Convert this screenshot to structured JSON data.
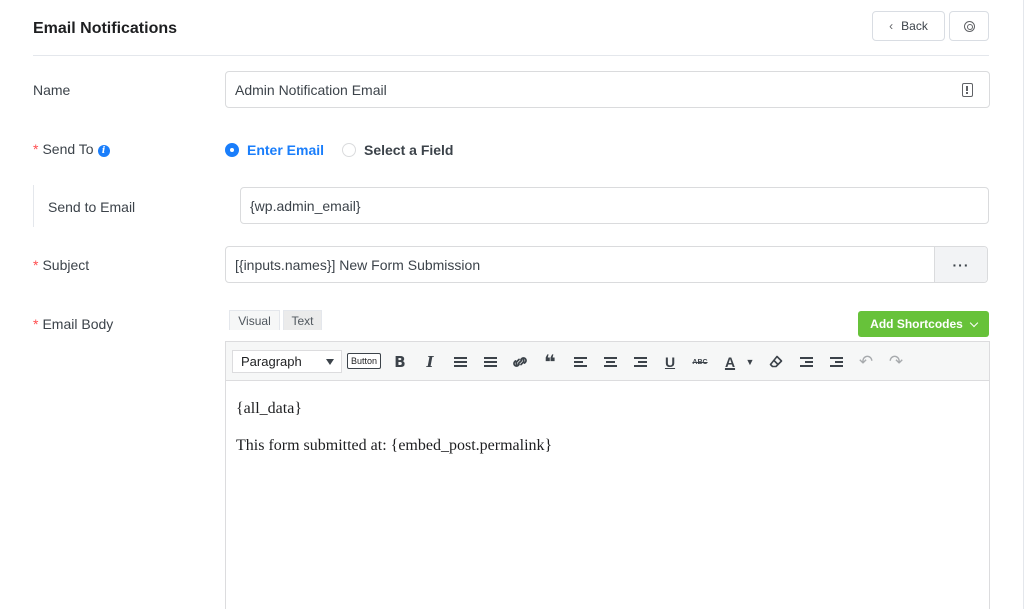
{
  "header": {
    "title": "Email Notifications",
    "back_label": "Back"
  },
  "fields": {
    "name": {
      "label": "Name",
      "value": "Admin Notification Email"
    },
    "send_to": {
      "label": "Send To",
      "options": [
        {
          "label": "Enter Email",
          "checked": true
        },
        {
          "label": "Select a Field",
          "checked": false
        }
      ]
    },
    "send_to_email": {
      "label": "Send to Email",
      "value": "{wp.admin_email}"
    },
    "subject": {
      "label": "Subject",
      "value": "[{inputs.names}] New Form Submission",
      "more_label": "···"
    },
    "email_body": {
      "label": "Email Body"
    }
  },
  "editor": {
    "tabs": [
      "Visual",
      "Text"
    ],
    "add_shortcodes_label": "Add Shortcodes",
    "format_select": "Paragraph",
    "button_tag": "Button",
    "toolbar_glyphs": {
      "bold": "B",
      "italic": "I",
      "quote": "❝",
      "underline": "U",
      "strike": "ABC",
      "text_color": "A"
    },
    "content": [
      "{all_data}",
      "This form submitted at: {embed_post.permalink}"
    ]
  },
  "colors": {
    "primary": "#1a7efb",
    "success": "#67c23a",
    "required": "#ff4d4f"
  }
}
